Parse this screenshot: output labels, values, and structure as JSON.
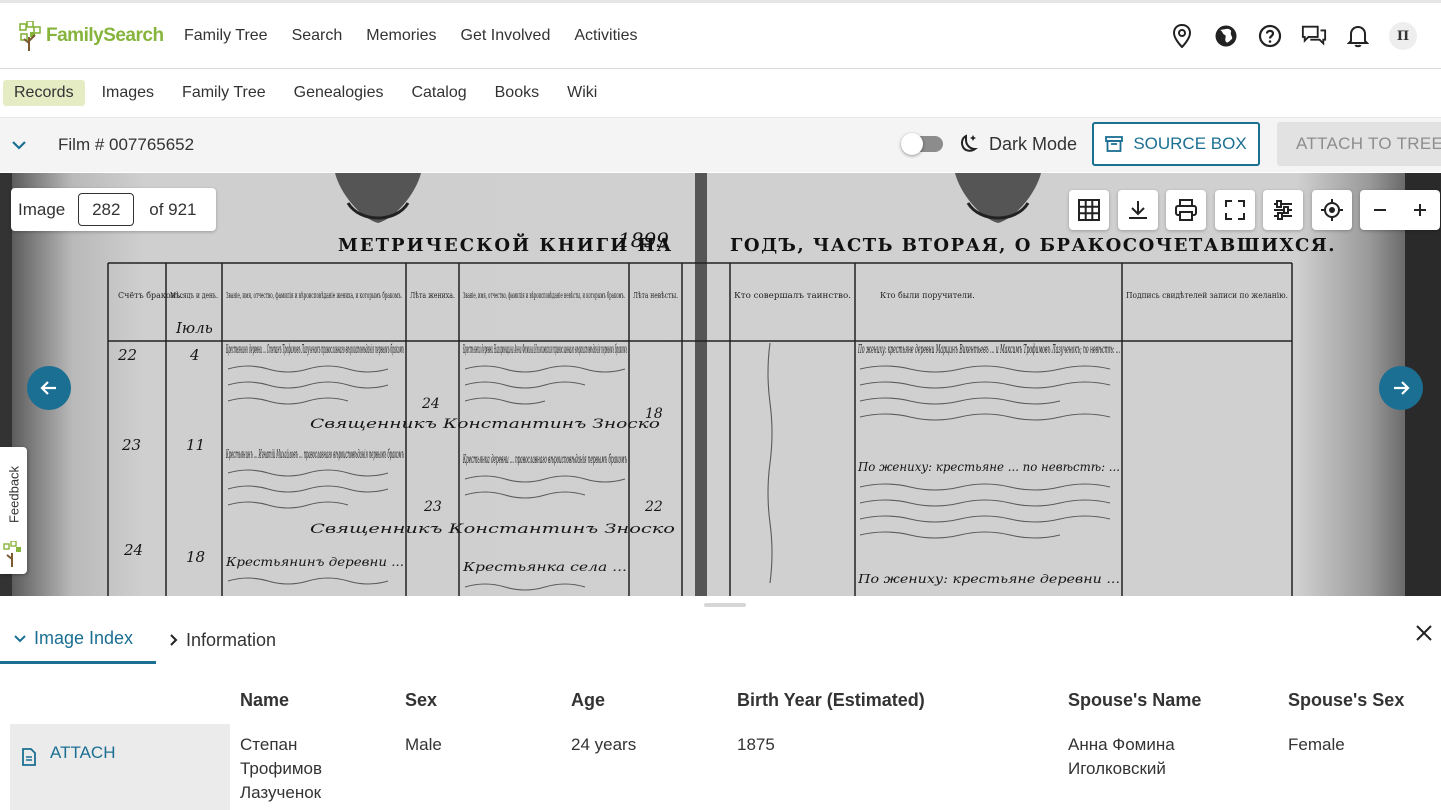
{
  "brand": {
    "name": "FamilySearch"
  },
  "nav": {
    "items": [
      "Family Tree",
      "Search",
      "Memories",
      "Get Involved",
      "Activities"
    ]
  },
  "header_icons": [
    "location-pin-icon",
    "globe-icon",
    "help-icon",
    "messages-icon",
    "bell-icon"
  ],
  "user": {
    "initial": "П"
  },
  "subnav": {
    "items": [
      "Records",
      "Images",
      "Family Tree",
      "Genealogies",
      "Catalog",
      "Books",
      "Wiki"
    ],
    "active": "Records"
  },
  "film": {
    "label": "Film # 007765652"
  },
  "dark_mode": {
    "label": "Dark Mode",
    "enabled": false
  },
  "buttons": {
    "source_box": "SOURCE BOX",
    "attach_to_tree": "ATTACH TO TREE"
  },
  "viewer": {
    "image_label": "Image",
    "current_image": "282",
    "total_label": "of 921",
    "tools": [
      "grid-icon",
      "download-icon",
      "print-icon",
      "fullscreen-icon",
      "adjust-icon",
      "locate-icon"
    ],
    "zoom_out": "−",
    "zoom_in": "+",
    "doc_title_left": "МЕТРИЧЕСКОЙ КНИГИ НА",
    "doc_year": "1899",
    "doc_title_right": "ГОДЪ, ЧАСТЬ ВТОРАЯ, О БРАКОСОЧЕТАВШИХСЯ.",
    "doc_headers": [
      "Счётъ браковъ.",
      "Мѣсяцъ и день.",
      "Званіе, имя, отчество, фамилія и вѣроисповѣданіе жениха, и которымъ бракомъ.",
      "Лѣта жениха.",
      "Званіе, имя, отчество, фамилія и вѣроисповѣданіе невѣсты, и которымъ бракомъ.",
      "Лѣта невѣсты.",
      "Кто совершалъ таинство.",
      "Кто были поручители.",
      "Подпись свидѣтелей записи по желанію."
    ],
    "doc_rows": [
      {
        "no": "22",
        "day": "4",
        "groom": "Крестьянинъ деревни ... Степанъ Трофимовъ Лазученокъ православнаго вѣроисповѣданія первымъ бракомъ",
        "groom_age": "24",
        "bride": "Крестьянка деревни Назаровщина Анна Фомина Иголковская православнаго вѣроисповѣданія первымъ бракомъ",
        "bride_age": "18",
        "witnesses": "По жениху: крестьяне деревни Марцинъ Викентьевъ ... и Максимъ Трофимовъ Лазученокъ; по невѣстѣ: ..."
      },
      {
        "no": "23",
        "day": "11",
        "groom": "Крестьянинъ ... Игнатій Михайловъ ... православнаго вѣроисповѣданія первымъ бракомъ",
        "groom_age": "23",
        "bride": "Крестьянка деревни ... православнаго вѣроисповѣданія первымъ бракомъ",
        "bride_age": "22",
        "witnesses": "По жениху: крестьяне ... по невѣстѣ: ..."
      },
      {
        "no": "24",
        "day": "18",
        "groom": "Крестьянинъ деревни ...",
        "groom_age": "",
        "bride": "Крестьянка села ...",
        "bride_age": "",
        "witnesses": "По жениху: крестьяне деревни ..."
      }
    ],
    "doc_month": "Іюль",
    "officiant": "Священникъ Константинъ Зноско"
  },
  "feedback": {
    "label": "Feedback"
  },
  "panel": {
    "tabs": [
      {
        "label": "Image Index",
        "active": true
      },
      {
        "label": "Information",
        "active": false
      }
    ],
    "columns": [
      "Name",
      "Sex",
      "Age",
      "Birth Year (Estimated)",
      "Spouse's Name",
      "Spouse's Sex"
    ],
    "attach_label": "ATTACH",
    "rows": [
      {
        "name": "Степан Трофимов Лазученок",
        "sex": "Male",
        "age": "24 years",
        "birth_year": "1875",
        "spouse_name": "Анна Фомина Иголковский",
        "spouse_sex": "Female"
      }
    ]
  },
  "colors": {
    "brand_green": "#86b43c",
    "accent_blue": "#1b6f93",
    "active_nav": "#e5ecc4"
  }
}
